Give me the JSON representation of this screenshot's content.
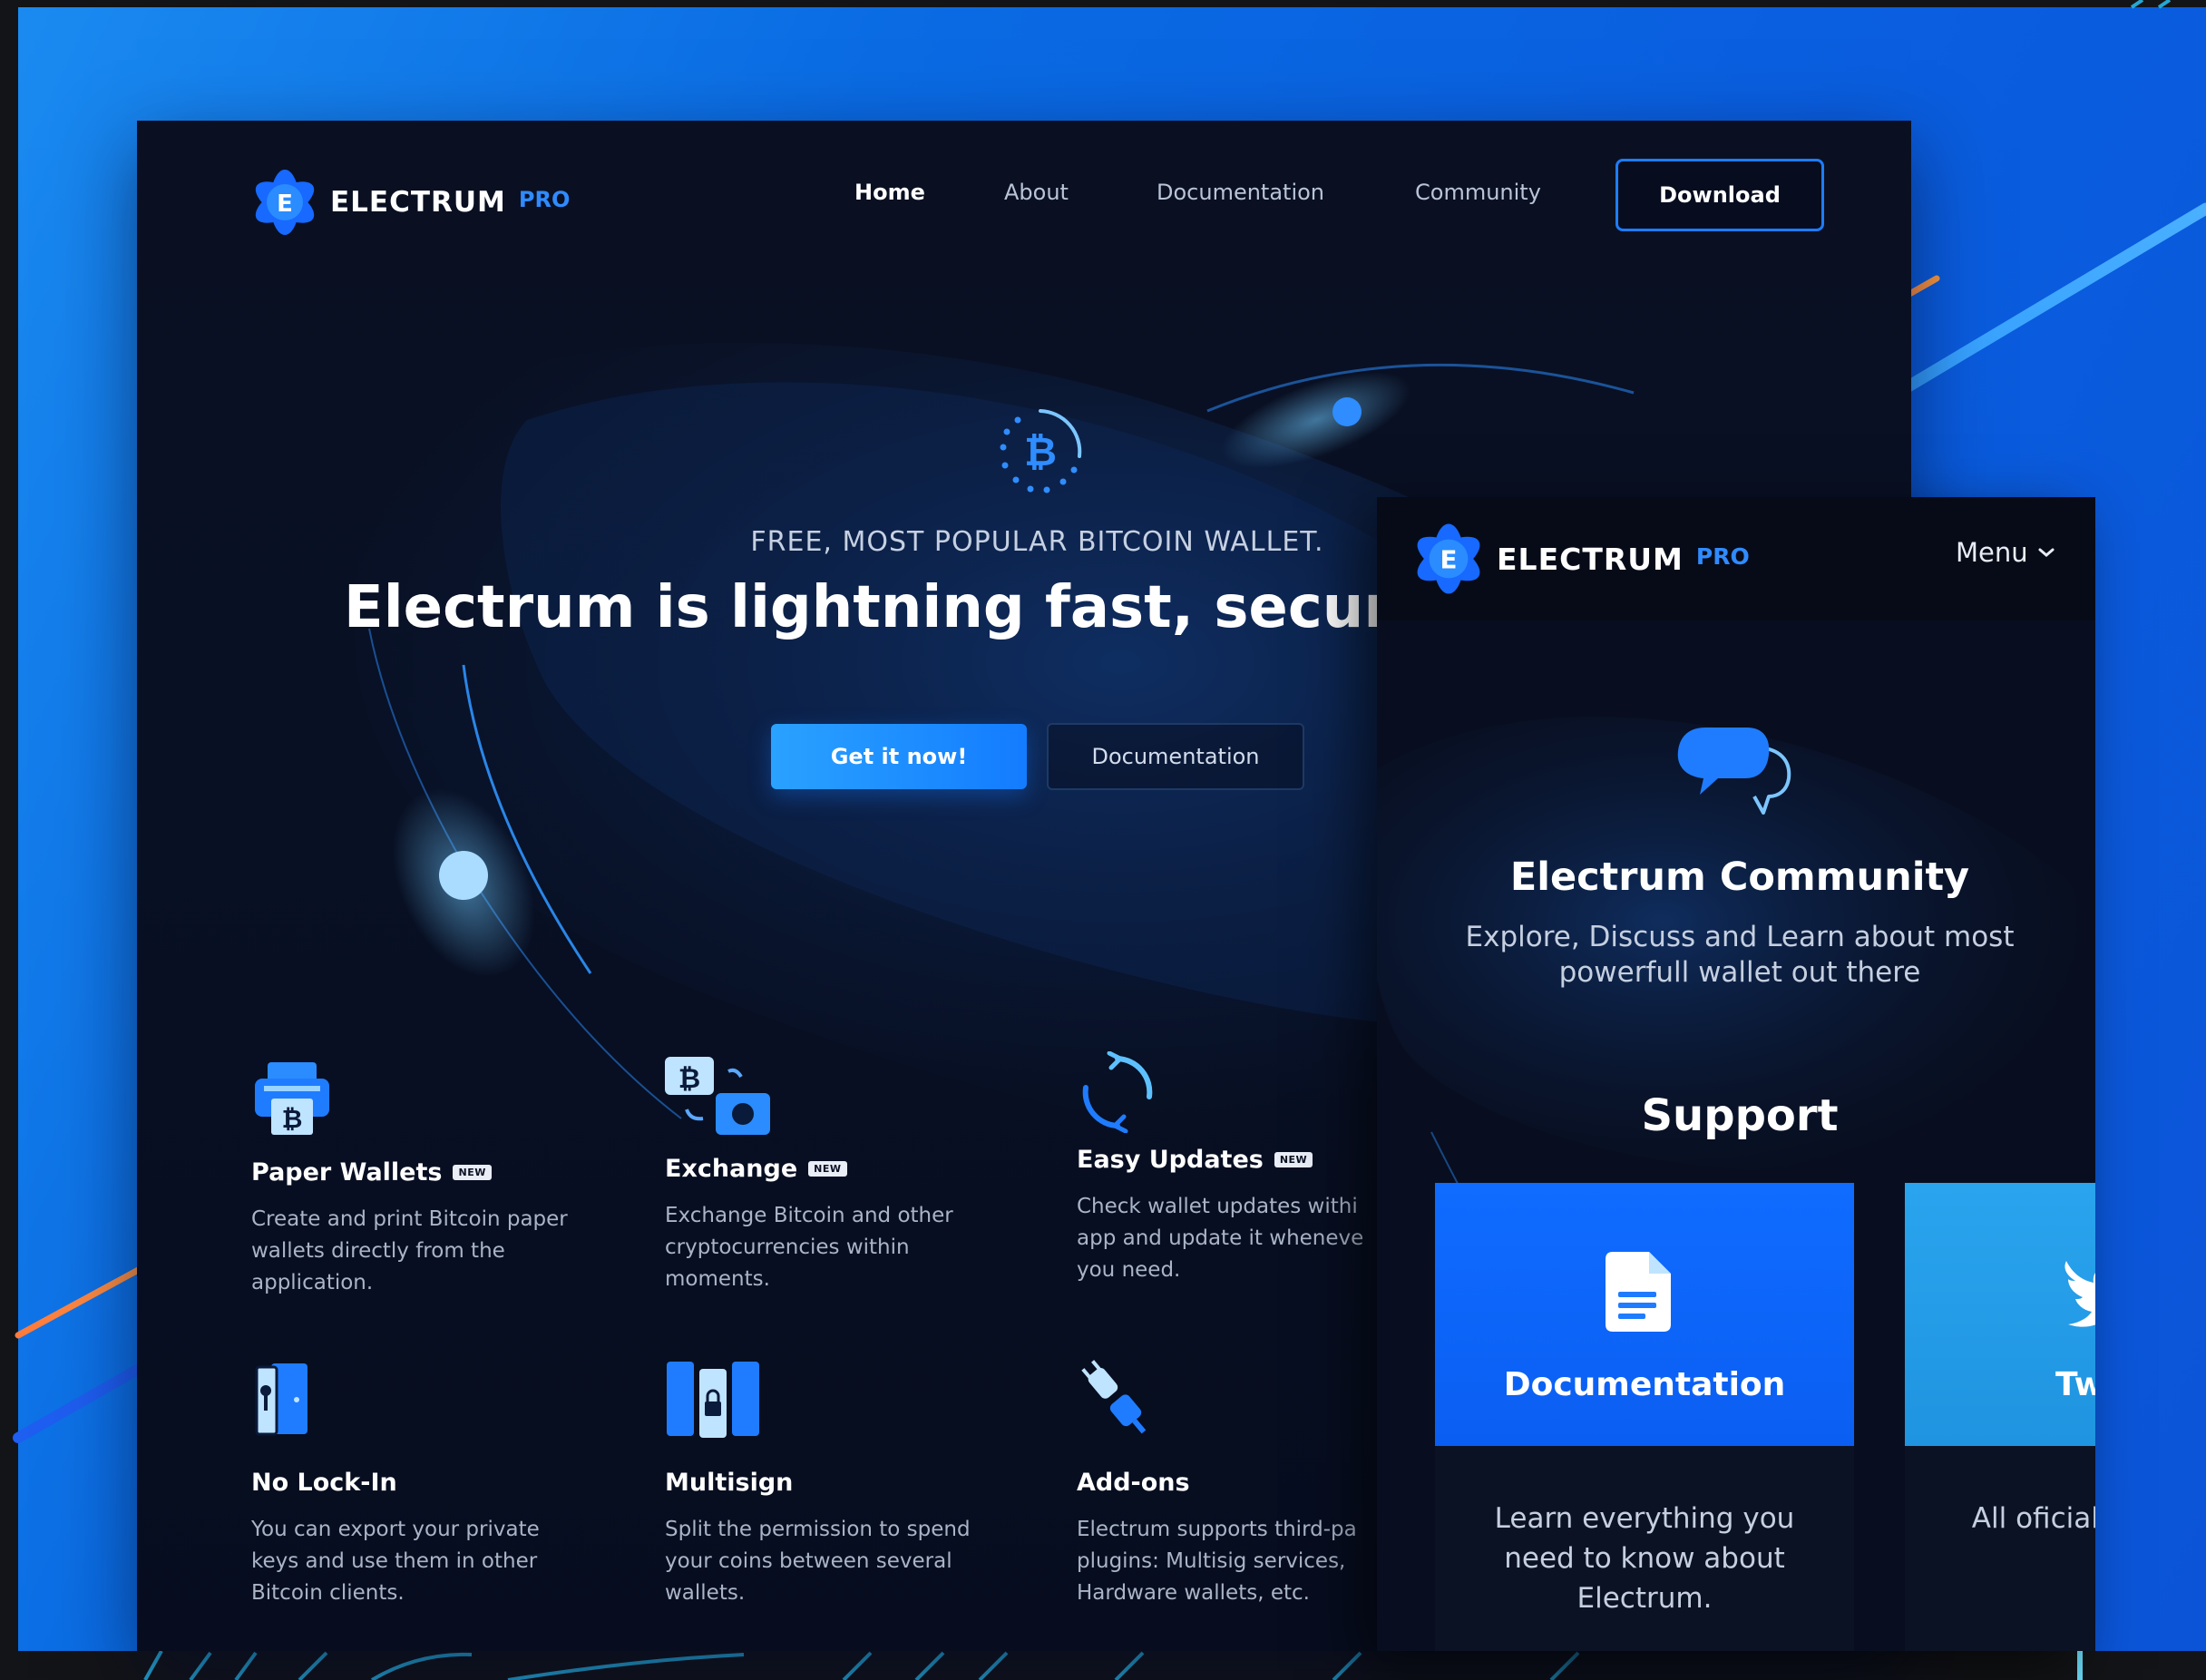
{
  "brand": {
    "name": "ELECTRUM",
    "tier": "PRO",
    "logo_letter": "E"
  },
  "nav": {
    "items": [
      {
        "label": "Home",
        "active": true
      },
      {
        "label": "About",
        "active": false
      },
      {
        "label": "Documentation",
        "active": false
      },
      {
        "label": "Community",
        "active": false
      }
    ],
    "download_label": "Download"
  },
  "hero": {
    "icon": "bitcoin-icon",
    "eyebrow": "FREE, MOST POPULAR BITCOIN WALLET.",
    "headline": "Electrum is lightning fast, secure and",
    "primary_cta": "Get it now!",
    "secondary_cta": "Documentation"
  },
  "features": [
    {
      "title": "Paper Wallets",
      "badge": "NEW",
      "icon": "printer-icon",
      "desc": "Create and print Bitcoin paper wallets directly from the application."
    },
    {
      "title": "Exchange",
      "badge": "NEW",
      "icon": "exchange-icon",
      "desc": "Exchange Bitcoin and other cryptocurrencies within moments."
    },
    {
      "title": "Easy Updates",
      "badge": "NEW",
      "icon": "refresh-icon",
      "desc": "Check wallet updates withi app and update it wheneve you need."
    },
    {
      "title": "No Lock-In",
      "badge": "",
      "icon": "door-key-icon",
      "desc": "You can export your private keys and use them in other Bitcoin clients."
    },
    {
      "title": "Multisign",
      "badge": "",
      "icon": "multisig-lock-icon",
      "desc": "Split the permission to spend your coins between several wallets."
    },
    {
      "title": "Add-ons",
      "badge": "",
      "icon": "plug-icon",
      "desc": "Electrum supports third-pa plugins: Multisig services, Hardware wallets, etc."
    }
  ],
  "mobile": {
    "menu_label": "Menu",
    "community_icon": "chat-bubbles-icon",
    "community_title": "Electrum Community",
    "community_desc": "Explore, Discuss and Learn about most powerfull wallet out there",
    "support_title": "Support",
    "cards": [
      {
        "title": "Documentation",
        "icon": "document-icon",
        "desc": "Learn everything you need to know about Electrum."
      },
      {
        "title": "Tw",
        "icon": "twitter-bird-icon",
        "desc": "All oficial c are publ"
      }
    ]
  },
  "colors": {
    "accent": "#1e7cff",
    "background": "#070d1f",
    "frame": "#0a6be3",
    "twitter": "#2aa4ee"
  }
}
